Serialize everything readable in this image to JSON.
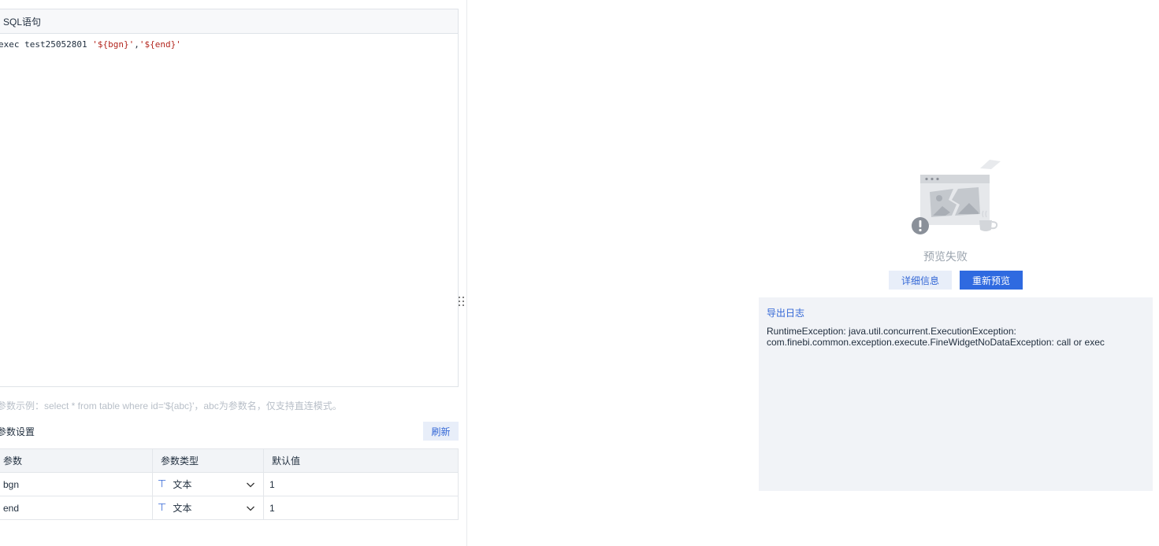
{
  "sql_editor": {
    "header": "SQL语句",
    "code_prefix": "exec test25052801 ",
    "code_arg1": "'${bgn}'",
    "code_sep": ",",
    "code_arg2": "'${end}'"
  },
  "hint": "参数示例：select * from table where id='${abc}'，abc为参数名，仅支持直连模式。",
  "params": {
    "title": "参数设置",
    "refresh_label": "刷新",
    "columns": [
      "参数",
      "参数类型",
      "默认值"
    ],
    "rows": [
      {
        "name": "bgn",
        "type": "文本",
        "default": "1"
      },
      {
        "name": "end",
        "type": "文本",
        "default": "1"
      }
    ],
    "type_icon": "text-type-icon"
  },
  "preview": {
    "status": "预览失败",
    "detail_label": "详细信息",
    "retry_label": "重新预览",
    "export_log_label": "导出日志",
    "error_line1": "RuntimeException: java.util.concurrent.ExecutionException:",
    "error_line2": "com.finebi.common.exception.execute.FineWidgetNoDataException: call or exec",
    "illustration_icon": "broken-image-error-icon"
  },
  "colors": {
    "accent": "#2f6ae0",
    "link": "#3367d6",
    "error_string": "#b3261e"
  }
}
